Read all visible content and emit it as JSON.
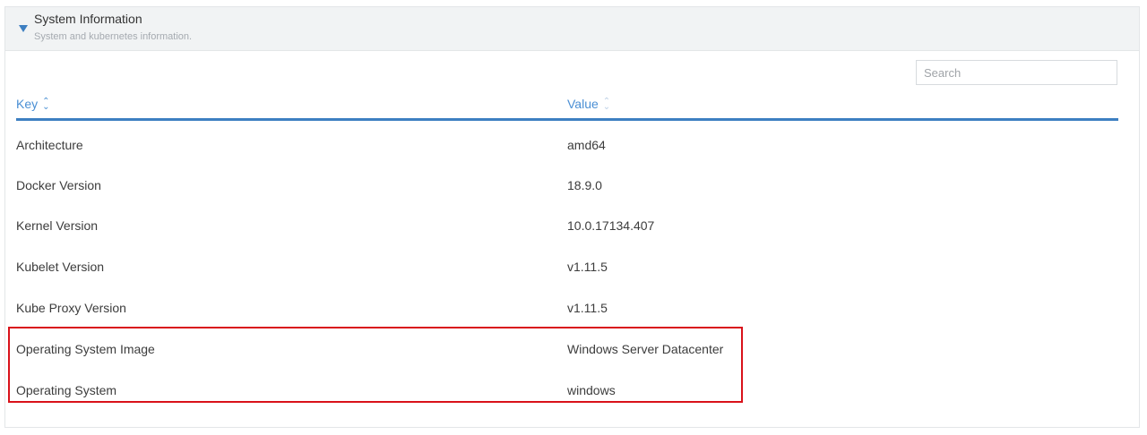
{
  "panel": {
    "title": "System Information",
    "subtitle": "System and kubernetes information."
  },
  "search": {
    "placeholder": "Search",
    "value": ""
  },
  "table": {
    "columns": [
      {
        "label": "Key",
        "sort": "active"
      },
      {
        "label": "Value",
        "sort": "inactive"
      }
    ],
    "rows": [
      {
        "key": "Architecture",
        "value": "amd64"
      },
      {
        "key": "Docker Version",
        "value": "18.9.0"
      },
      {
        "key": "Kernel Version",
        "value": "10.0.17134.407"
      },
      {
        "key": "Kubelet Version",
        "value": "v1.11.5"
      },
      {
        "key": "Kube Proxy Version",
        "value": "v1.11.5"
      },
      {
        "key": "Operating System Image",
        "value": "Windows Server Datacenter"
      },
      {
        "key": "Operating System",
        "value": "windows"
      }
    ]
  },
  "colors": {
    "accent": "#3d7fc1",
    "highlight_border": "#d9121a",
    "header_bg": "#f1f3f4"
  }
}
